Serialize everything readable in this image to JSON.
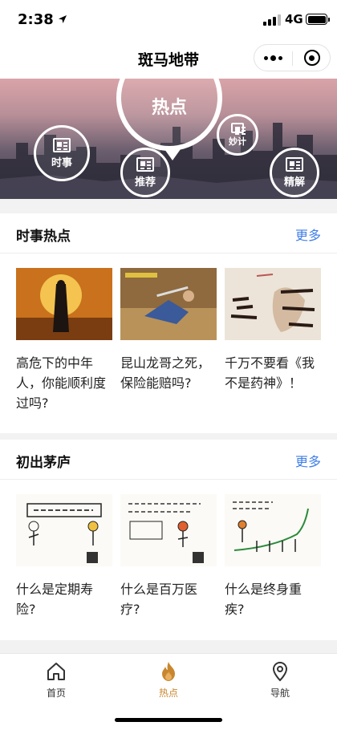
{
  "status_bar": {
    "time": "2:38",
    "network": "4G"
  },
  "nav": {
    "title": "斑马地带"
  },
  "banner": {
    "center_label": "热点",
    "bubbles": [
      "时事",
      "推荐",
      "妙计",
      "精解"
    ]
  },
  "sections": [
    {
      "title": "时事热点",
      "more": "更多",
      "cards": [
        {
          "title": "高危下的中年人，你能顺利度过吗?"
        },
        {
          "title": "昆山龙哥之死，保险能赔吗?"
        },
        {
          "title": "千万不要看《我不是药神》！"
        }
      ]
    },
    {
      "title": "初出茅庐",
      "more": "更多",
      "cards": [
        {
          "title": "什么是定期寿险?"
        },
        {
          "title": "什么是百万医疗?"
        },
        {
          "title": "什么是终身重疾?"
        }
      ]
    }
  ],
  "tabbar": {
    "tabs": [
      {
        "label": "首页",
        "icon": "home-icon"
      },
      {
        "label": "热点",
        "icon": "flame-icon"
      },
      {
        "label": "导航",
        "icon": "location-pin-icon"
      }
    ],
    "active_index": 1,
    "active_color": "#c8872f"
  },
  "colors": {
    "link": "#3f7ee8",
    "section_gap": "#f2f2f2"
  }
}
